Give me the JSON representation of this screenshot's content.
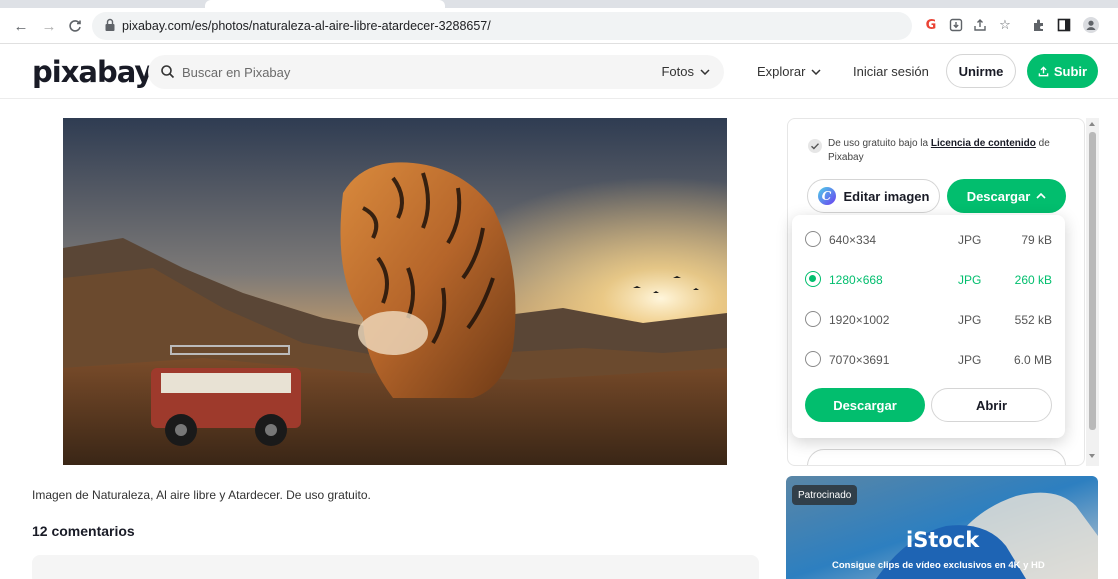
{
  "browser": {
    "url": "pixabay.com/es/photos/naturaleza-al-aire-libre-atardecer-3288657/",
    "icons": [
      "back-icon",
      "forward-icon",
      "reload-icon",
      "lock-icon",
      "google-icon",
      "install-icon",
      "share-icon",
      "star-icon",
      "extensions-icon",
      "sidepanel-icon",
      "profile-icon"
    ]
  },
  "header": {
    "logo": "pixabay",
    "search_placeholder": "Buscar en Pixabay",
    "search_scope": "Fotos",
    "explore": "Explorar",
    "login": "Iniciar sesión",
    "join": "Unirme",
    "upload": "Subir"
  },
  "main": {
    "caption": "Imagen de Naturaleza, Al aire libre y Atardecer. De uso gratuito.",
    "comments_title": "12 comentarios"
  },
  "panel": {
    "license_text": "De uso gratuito bajo la",
    "license_link": "Licencia de contenido",
    "license_suffix": "de Pixabay",
    "edit_label": "Editar imagen",
    "download_label": "Descargar"
  },
  "download_options": [
    {
      "resolution": "640×334",
      "format": "JPG",
      "size": "79 kB",
      "selected": false
    },
    {
      "resolution": "1280×668",
      "format": "JPG",
      "size": "260 kB",
      "selected": true
    },
    {
      "resolution": "1920×1002",
      "format": "JPG",
      "size": "552 kB",
      "selected": false
    },
    {
      "resolution": "7070×3691",
      "format": "JPG",
      "size": "6.0 MB",
      "selected": false
    }
  ],
  "dropdown": {
    "download_label": "Descargar",
    "open_label": "Abrir"
  },
  "ad": {
    "badge": "Patrocinado",
    "brand": "iStock",
    "text": "Consigue clips de vídeo exclusivos en 4K y HD"
  },
  "colors": {
    "accent": "#02be6e",
    "text": "#191b26"
  }
}
